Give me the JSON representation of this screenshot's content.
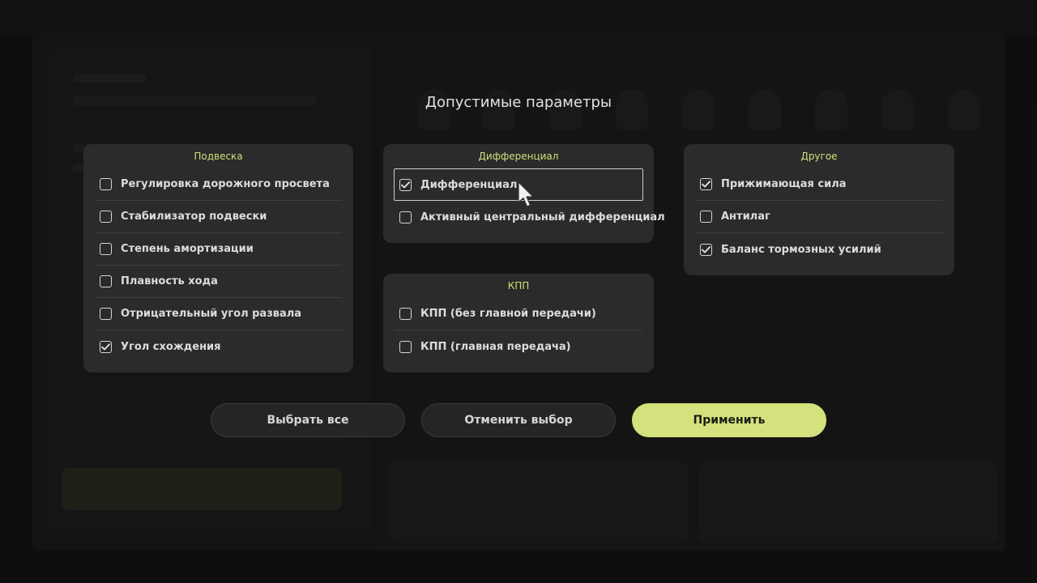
{
  "dialog": {
    "title": "Допустимые параметры"
  },
  "panels": {
    "suspension": {
      "title": "Подвеска",
      "options": [
        {
          "label": "Регулировка дорожного просвета",
          "checked": false
        },
        {
          "label": "Стабилизатор подвески",
          "checked": false
        },
        {
          "label": "Степень амортизации",
          "checked": false
        },
        {
          "label": "Плавность хода",
          "checked": false
        },
        {
          "label": "Отрицательный угол развала",
          "checked": false
        },
        {
          "label": "Угол схождения",
          "checked": true
        }
      ]
    },
    "differential": {
      "title": "Дифференциал",
      "options": [
        {
          "label": "Дифференциал",
          "checked": true,
          "focused": true
        },
        {
          "label": "Активный центральный дифференциал",
          "checked": false
        }
      ]
    },
    "gearbox": {
      "title": "КПП",
      "options": [
        {
          "label": "КПП (без главной передачи)",
          "checked": false
        },
        {
          "label": "КПП (главная передача)",
          "checked": false
        }
      ]
    },
    "other": {
      "title": "Другое",
      "options": [
        {
          "label": "Прижимающая сила",
          "checked": true
        },
        {
          "label": "Антилаг",
          "checked": false
        },
        {
          "label": "Баланс тормозных усилий",
          "checked": true
        }
      ]
    }
  },
  "buttons": {
    "select_all": "Выбрать все",
    "deselect": "Отменить выбор",
    "apply": "Применить"
  },
  "colors": {
    "accent": "#d4e17c",
    "panel": "#2a2b2a",
    "background": "#141514"
  },
  "icons": {
    "checkbox_checked": "check-icon",
    "cursor": "mouse-pointer-icon"
  }
}
